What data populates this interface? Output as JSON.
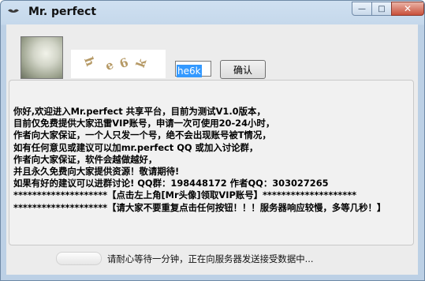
{
  "window": {
    "title": "Mr. perfect",
    "minimize_label": "—",
    "maximize_label": "□",
    "close_label": "✕"
  },
  "captcha": {
    "image_text": "he6k",
    "input_value": "he6k",
    "confirm_label": "确认"
  },
  "notice": {
    "lines": [
      "你好,欢迎进入Mr.perfect 共享平台，目前为测试V1.0版本，",
      "目前仅免费提供大家迅雷VIP账号，申请一次可使用20-24小时，",
      "作者向大家保证，一个人只发一个号，绝不会出现账号被T情况，",
      "如有任何意见或建议可以加mr.perfect QQ 或加入讨论群，",
      "作者向大家保证，软件会越做越好，",
      "并且永久免费向大家提供资源！敬请期待!",
      "如果有好的建议可以进群讨论! QQ群：198448172 作者QQ：303027265",
      "********************【点击左上角[Mr头像]领取VIP账号】********************",
      "********************【请大家不要重复点击任何按钮！！！服务器响应较慢，多等几秒！】"
    ]
  },
  "status": {
    "text": "请耐心等待一分钟，正在向服务器发送接受数据中..."
  }
}
